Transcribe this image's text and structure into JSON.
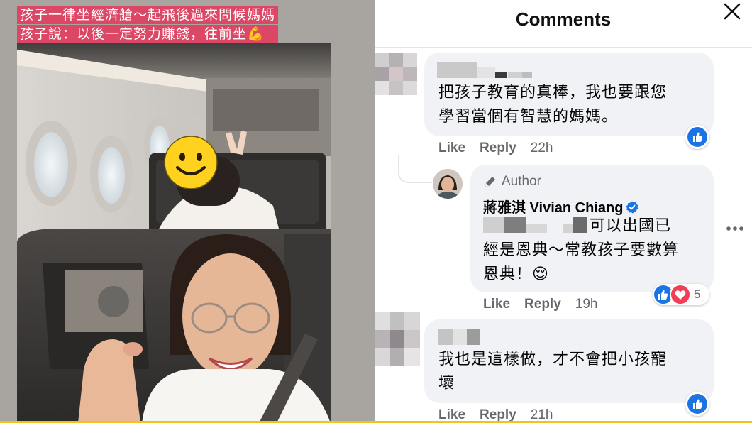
{
  "story": {
    "caption_line1": "孩子一律坐經濟艙～起飛後過來問候媽媽",
    "caption_line2": "孩子說：以後一定努力賺錢，往前坐",
    "caption_emoji": "💪",
    "face_cover": "smiley-sticker"
  },
  "panel": {
    "title": "Comments",
    "close_icon": "close-icon",
    "more_icon": "more-options-icon"
  },
  "comments": [
    {
      "text_line1": "把孩子教育的真棒，我也要跟您",
      "text_line2": "學習當個有智慧的媽媽。",
      "like_label": "Like",
      "reply_label": "Reply",
      "time": "22h",
      "reaction": "like"
    },
    {
      "author_tag": "Author",
      "author_name": "蔣雅淇 Vivian Chiang",
      "text_line1_suffix": "可以出國已",
      "text_line2": "經是恩典～常教孩子要數算",
      "text_line3": "恩典！",
      "text_emoji": "😌",
      "like_label": "Like",
      "reply_label": "Reply",
      "time": "19h",
      "reactions": [
        "like",
        "love"
      ],
      "reaction_count": "5"
    },
    {
      "text_line1": "我也是這樣做，才不會把小孩寵",
      "text_line2": "壞",
      "like_label": "Like",
      "reply_label": "Reply",
      "time": "21h",
      "reaction": "like"
    }
  ],
  "colors": {
    "caption_bg": "#e23a5c",
    "bubble_bg": "#f0f2f5",
    "meta_text": "#65676b",
    "like_blue": "#1b74e4",
    "love_red": "#f33e58",
    "divider": "#e4e6eb"
  }
}
